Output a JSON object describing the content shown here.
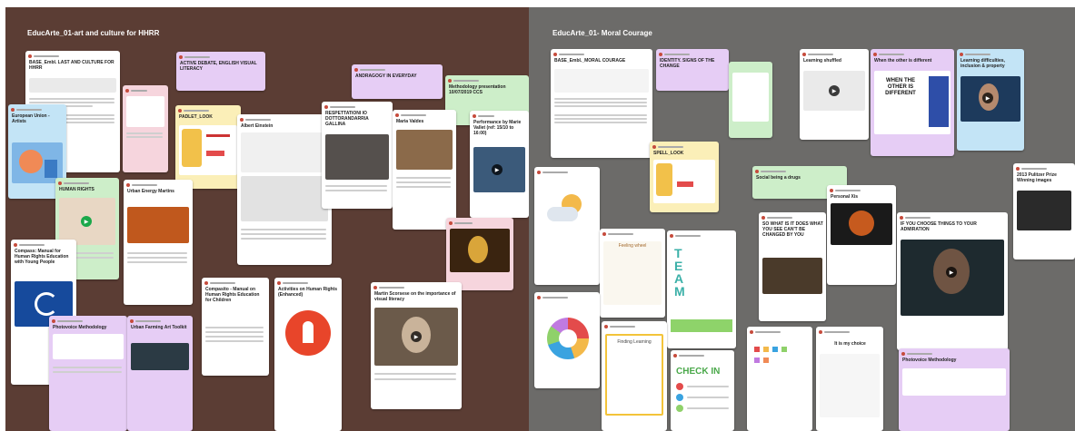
{
  "board": {
    "left": {
      "title": "EducArte_01-art and culture for HHRR",
      "subtitle": "",
      "accent": "#5b3d34"
    },
    "right": {
      "title": "EducArte_01- Moral Courage",
      "subtitle": "",
      "accent": "#6c6b69"
    }
  },
  "left_cards": {
    "c1_title": "BASE_Embl. LAST AND CULTURE FOR HHRR",
    "c2_title": "ACTIVE DEBATE, ENGLISH VISUAL LITERACY",
    "c3_title": "ANDRAGOGY IN EVERYDAY",
    "c4_title": "Methodology presentation 10/07/2019 CCS",
    "c5_title": "European Union - Artists",
    "c6_title": "PADLET_LOOK",
    "c7_title": "Albert Einstein",
    "c8_title": "RESPETTATIONI IO DOTTORANDARRIA GALLINA",
    "c9_title": "Maria Valdes",
    "c10_title": "Performance by Marie Vallet (ref: 15/10 to 16:00)",
    "c11_title": "HUMAN RIGHTS",
    "c12_title": "Urban Energy Martins",
    "c13_title": "Compass: Manual for Human Rights Education with Young People",
    "c14_title": "Compasito - Manual on Human Rights Education for Children",
    "c15_title": "Activities on Human Rights (Enhanced)",
    "c16_title": "Martin Scorsese on the importance of visual literacy",
    "c17_title": "Photovoice Methodology",
    "c18_title": "Urban Farming Art Toolkit"
  },
  "right_cards": {
    "r1_title": "BASE_Embl._MORAL COURAGE",
    "r2_title": "IDENTITY. SIGNS OF THE CHANGE",
    "r3_title": "Learning shuffled",
    "r4_title": "When the other is different",
    "r4_big": "WHEN THE OTHER IS DIFFERENT",
    "r5_title": "Learning difficulties, inclusion & property",
    "r6_title": "SPELL_LOOK",
    "r7_title": "Social being a drugs",
    "r8_title": "Personal Xis",
    "r9_title": "SO WHAT IS IT DOES WHAT YOU SEE CAN'T BE CHANGED BY YOU",
    "r10_title": "IF YOU CHOOSE THINGS TO YOUR ADMIRATION",
    "r11_title": "2013 Pulitzer Prize Winning images",
    "r12_title": "TEAM",
    "r13_title": "CHECK IN",
    "r14_title": "Photovoice Methodology",
    "r15_title": "It is my choice",
    "r16_title": "Feeling wheel",
    "r17_title": "Finding Learning"
  }
}
